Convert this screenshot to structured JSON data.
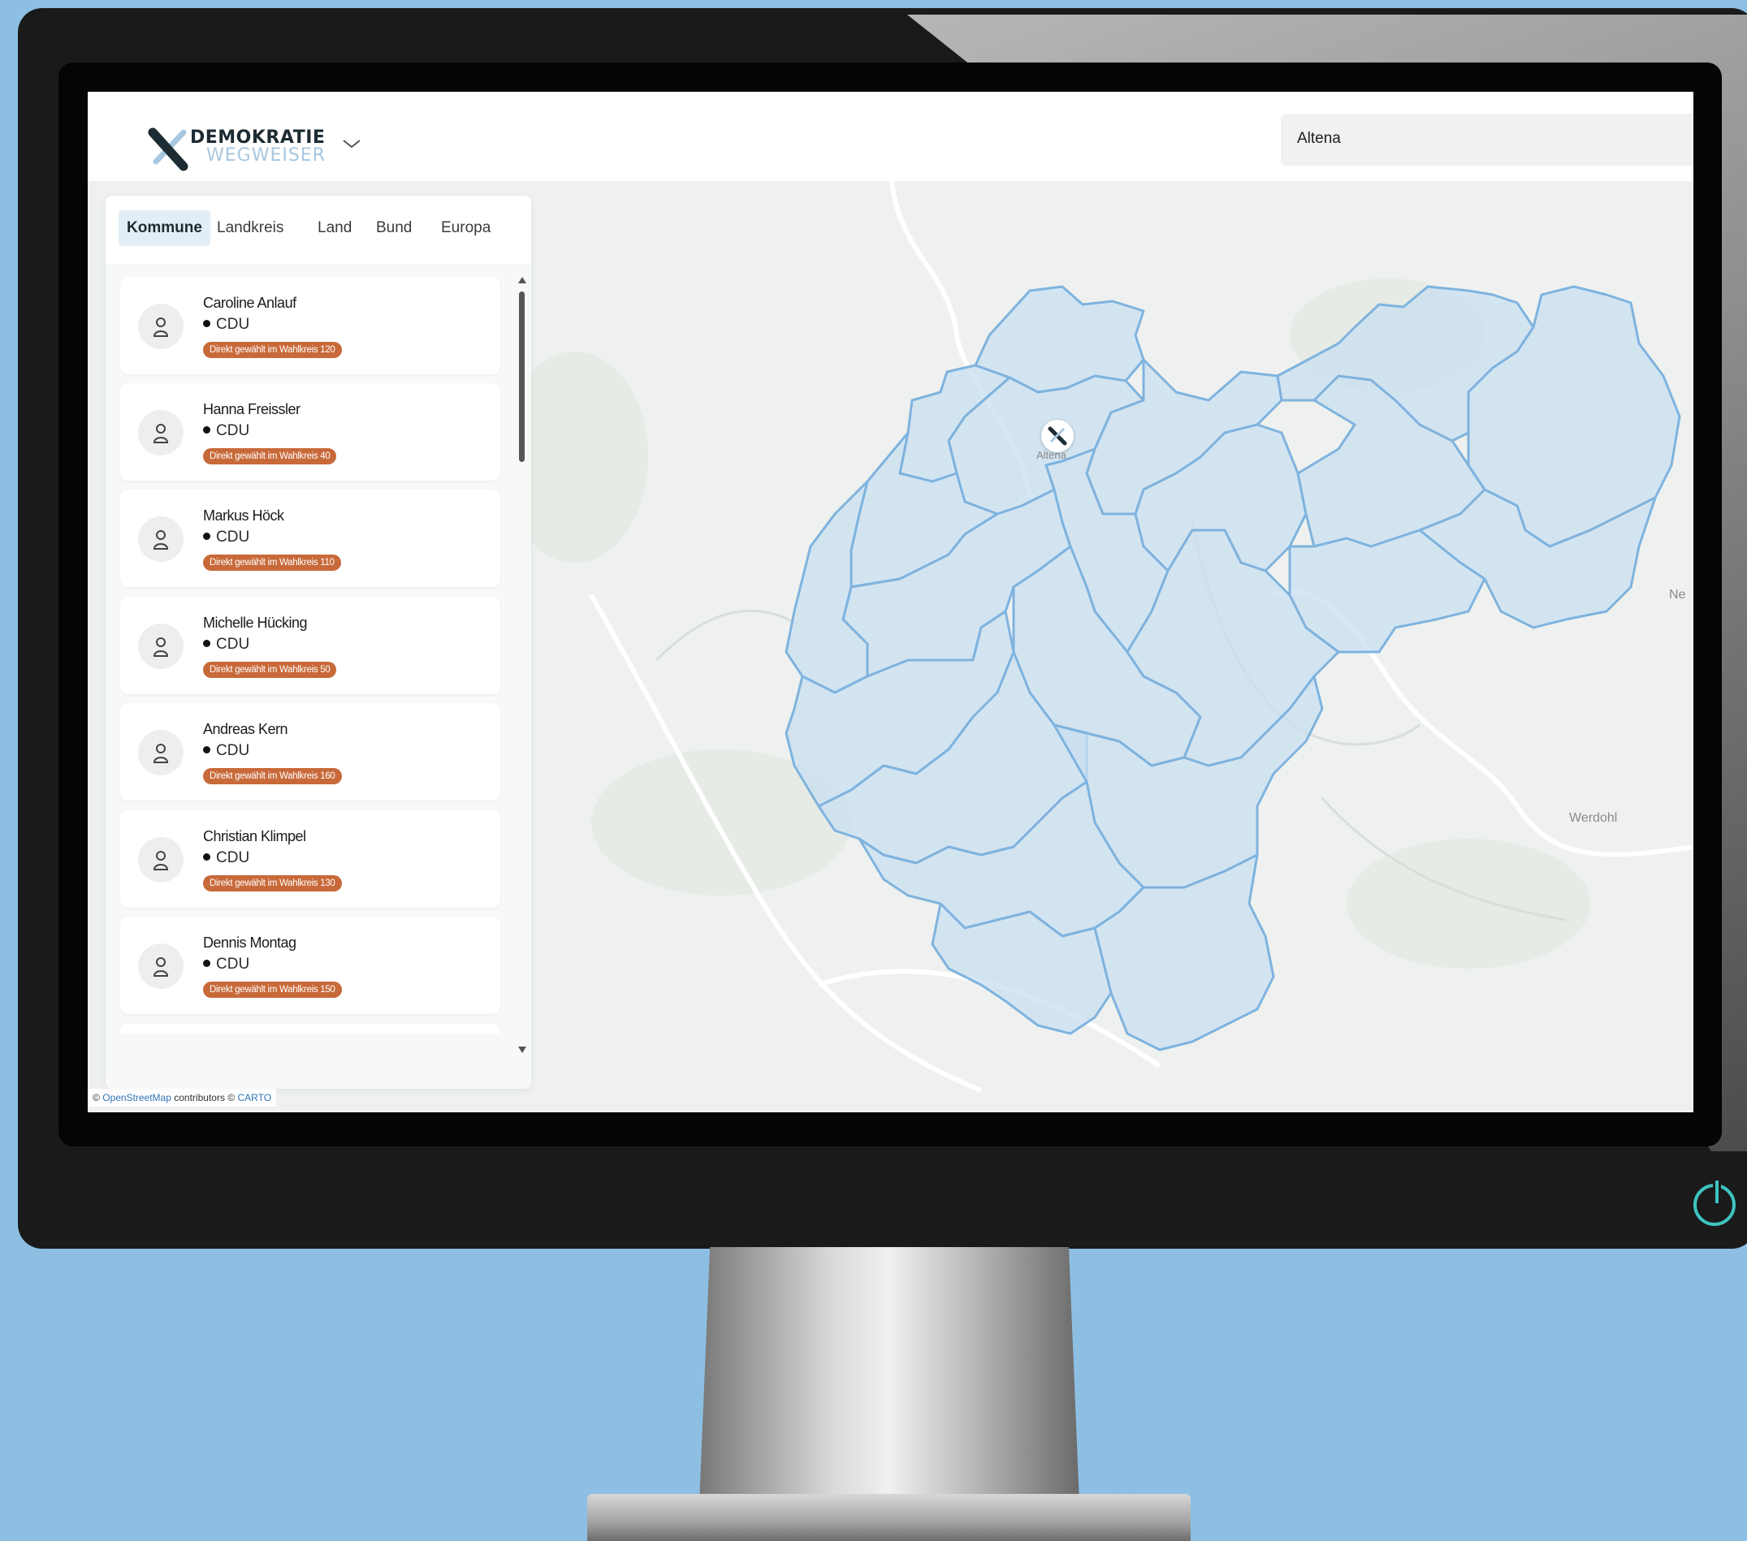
{
  "header": {
    "logo_line1": "DEMOKRATIE",
    "logo_line2": "WEGWEISER",
    "search_value": "Altena"
  },
  "tabs": [
    {
      "label": "Kommune",
      "active": true
    },
    {
      "label": "Landkreis",
      "active": false
    },
    {
      "label": "Land",
      "active": false
    },
    {
      "label": "Bund",
      "active": false
    },
    {
      "label": "Europa",
      "active": false
    }
  ],
  "representatives": [
    {
      "name": "Caroline Anlauf",
      "party": "CDU",
      "badge": "Direkt gewählt im Wahlkreis 120"
    },
    {
      "name": "Hanna Freissler",
      "party": "CDU",
      "badge": "Direkt gewählt im Wahlkreis 40"
    },
    {
      "name": "Markus Höck",
      "party": "CDU",
      "badge": "Direkt gewählt im Wahlkreis 110"
    },
    {
      "name": "Michelle Hücking",
      "party": "CDU",
      "badge": "Direkt gewählt im Wahlkreis 50"
    },
    {
      "name": "Andreas Kern",
      "party": "CDU",
      "badge": "Direkt gewählt im Wahlkreis 160"
    },
    {
      "name": "Christian Klimpel",
      "party": "CDU",
      "badge": "Direkt gewählt im Wahlkreis 130"
    },
    {
      "name": "Dennis Montag",
      "party": "CDU",
      "badge": "Direkt gewählt im Wahlkreis 150"
    }
  ],
  "map": {
    "labels": {
      "werdohl": "Werdohl",
      "ne": "Ne",
      "altena": "Altena"
    },
    "attribution": {
      "prefix": "©",
      "osm": "OpenStreetMap",
      "middle": "contributors ©",
      "carto": "CARTO"
    }
  },
  "colors": {
    "accent": "#c8693a",
    "district_fill": "#c9dff1",
    "district_stroke": "#7fb3de",
    "power": "#3dc4c0"
  }
}
